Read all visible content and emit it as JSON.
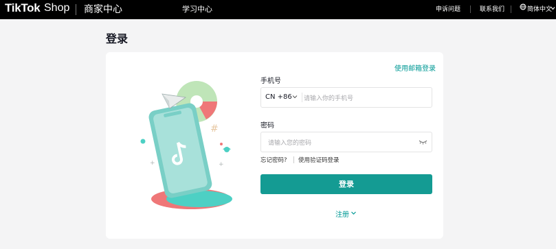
{
  "header": {
    "brand": "TikTok",
    "brand_suffix": "Shop",
    "merchant_center": "商家中心",
    "nav_learning": "学习中心",
    "appeal": "申诉问题",
    "contact": "联系我们",
    "language": "简体中文"
  },
  "page": {
    "title": "登录"
  },
  "login": {
    "email_login_link": "使用邮箱登录",
    "phone_label": "手机号",
    "country_code": "CN +86",
    "phone_placeholder": "请输入你的手机号",
    "password_label": "密码",
    "password_placeholder": "请输入您的密码",
    "forgot_password": "忘记密码?",
    "code_login": "使用验证码登录",
    "login_button": "登录",
    "register": "注册"
  },
  "colors": {
    "accent": "#149b93",
    "link": "#009995",
    "topbar": "#000000",
    "background": "#f4f4f5"
  }
}
